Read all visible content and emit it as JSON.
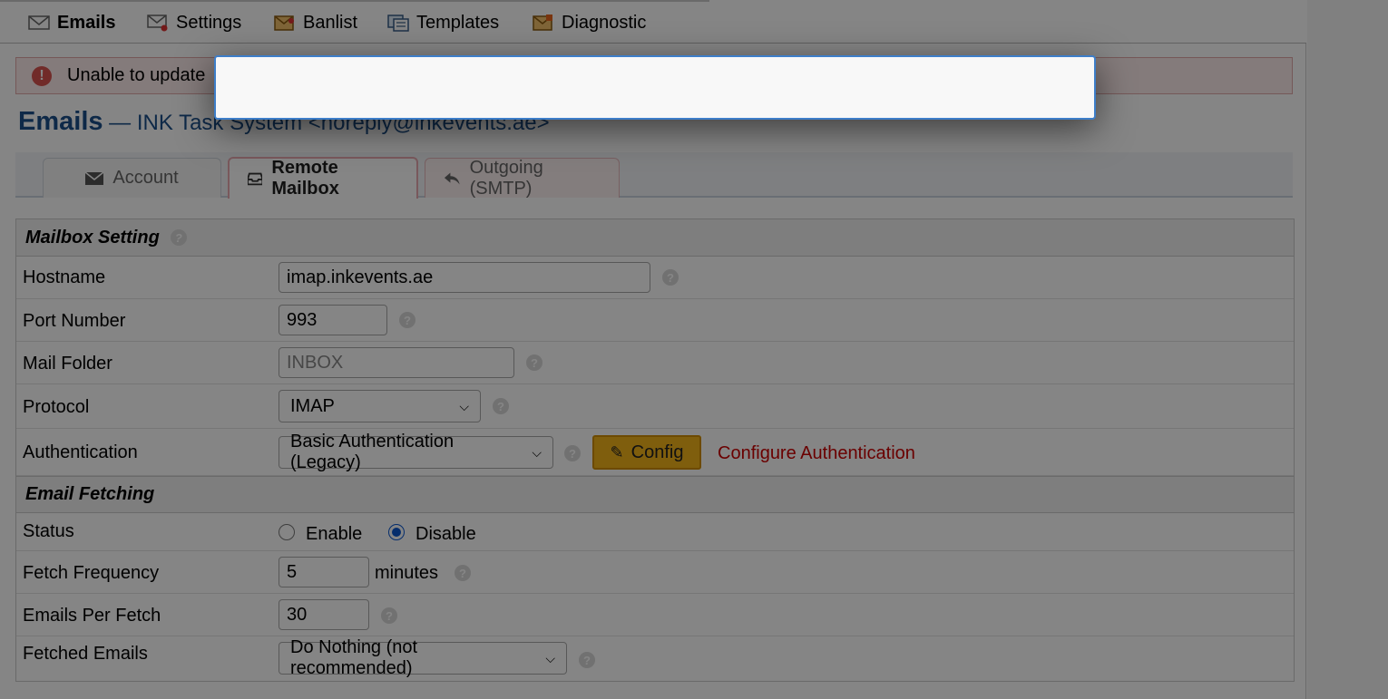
{
  "subnav": {
    "items": [
      {
        "label": "Emails",
        "icon": "envelope-icon",
        "active": true
      },
      {
        "label": "Settings",
        "icon": "envelope-settings-icon"
      },
      {
        "label": "Banlist",
        "icon": "banlist-icon"
      },
      {
        "label": "Templates",
        "icon": "templates-icon"
      },
      {
        "label": "Diagnostic",
        "icon": "diagnostic-icon"
      }
    ]
  },
  "alert": {
    "icon": "!",
    "text": "Unable to update"
  },
  "heading": {
    "title": "Emails",
    "subtitle": "— INK Task System <noreply@inkevents.ae>"
  },
  "tabs": [
    {
      "label": "Account",
      "icon": "envelope-icon"
    },
    {
      "label": "Remote Mailbox",
      "icon": "inbox-icon",
      "active": true
    },
    {
      "label": "Outgoing (SMTP)",
      "icon": "reply-icon"
    }
  ],
  "mailbox": {
    "section_title": "Mailbox Setting",
    "hostname_label": "Hostname",
    "hostname_value": "imap.inkevents.ae",
    "port_label": "Port Number",
    "port_value": "993",
    "folder_label": "Mail Folder",
    "folder_placeholder": "INBOX",
    "protocol_label": "Protocol",
    "protocol_value": "IMAP",
    "auth_label": "Authentication",
    "auth_value": "Basic Authentication (Legacy)",
    "config_button": "Config",
    "config_link": "Configure Authentication"
  },
  "fetching": {
    "section_title": "Email Fetching",
    "status_label": "Status",
    "status_enable": "Enable",
    "status_disable": "Disable",
    "status_selected": "Disable",
    "frequency_label": "Fetch Frequency",
    "frequency_value": "5",
    "frequency_unit": "minutes",
    "per_fetch_label": "Emails Per Fetch",
    "per_fetch_value": "30",
    "fetched_label": "Fetched Emails",
    "fetched_value": "Do Nothing (not recommended)"
  },
  "help_icon": "?",
  "colors": {
    "heading": "#1b4f8a",
    "alert_bg": "#fdecec",
    "config_button": "#f4b41a",
    "config_link": "#cc0000",
    "modal_border": "#3d7ec9",
    "radio_checked": "#0b57d0"
  }
}
